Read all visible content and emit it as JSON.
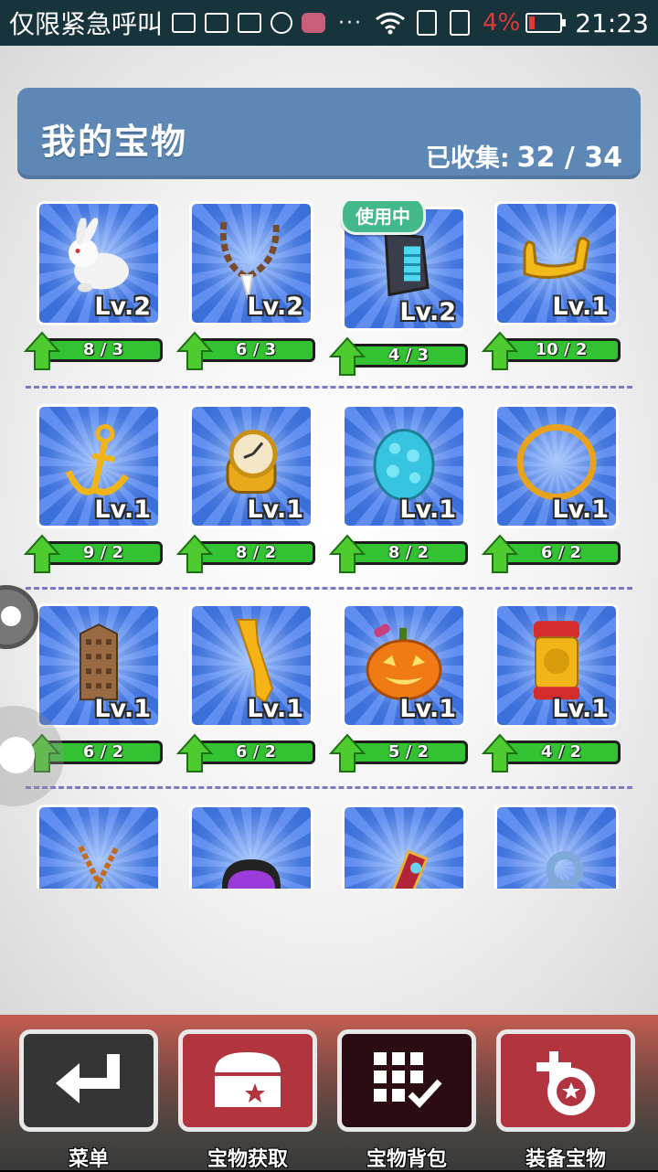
{
  "status": {
    "carrier": "仅限紧急呼叫",
    "battery_pct": "4%",
    "time": "21:23"
  },
  "header": {
    "title": "我的宝物",
    "collected_label": "已收集:",
    "collected_value": "32 / 34"
  },
  "badge_in_use": "使用中",
  "rows": [
    [
      {
        "name": "rabbit",
        "level": "Lv.2",
        "progress": "8 / 3"
      },
      {
        "name": "tooth-necklace",
        "level": "Lv.2",
        "progress": "6 / 3"
      },
      {
        "name": "gauntlet",
        "level": "Lv.2",
        "progress": "4 / 3",
        "in_use": true
      },
      {
        "name": "golden-slingshot",
        "level": "Lv.1",
        "progress": "10 / 2"
      }
    ],
    [
      {
        "name": "anchor",
        "level": "Lv.1",
        "progress": "9 / 2"
      },
      {
        "name": "pocket-watch",
        "level": "Lv.1",
        "progress": "8 / 2"
      },
      {
        "name": "blue-egg",
        "level": "Lv.1",
        "progress": "8 / 2"
      },
      {
        "name": "golden-ring",
        "level": "Lv.1",
        "progress": "6 / 2"
      }
    ],
    [
      {
        "name": "tower",
        "level": "Lv.1",
        "progress": "6 / 2"
      },
      {
        "name": "golden-key",
        "level": "Lv.1",
        "progress": "6 / 2"
      },
      {
        "name": "pumpkin",
        "level": "Lv.1",
        "progress": "5 / 2"
      },
      {
        "name": "golden-lantern",
        "level": "Lv.1",
        "progress": "4 / 2"
      }
    ],
    [
      {
        "name": "star-medal",
        "level": "",
        "progress": ""
      },
      {
        "name": "helmet",
        "level": "",
        "progress": ""
      },
      {
        "name": "red-scroll",
        "level": "",
        "progress": ""
      },
      {
        "name": "wrench",
        "level": "",
        "progress": ""
      }
    ]
  ],
  "bottom_nav": [
    {
      "label": "菜单",
      "icon": "return-icon"
    },
    {
      "label": "宝物获取",
      "icon": "chest-icon"
    },
    {
      "label": "宝物背包",
      "icon": "grid-check-icon"
    },
    {
      "label": "装备宝物",
      "icon": "equip-icon"
    }
  ],
  "colors": {
    "header_bg": "#5d87b5",
    "progress_green": "#33c232",
    "badge_green": "#43b88a",
    "nav_red": "#b2343f"
  }
}
